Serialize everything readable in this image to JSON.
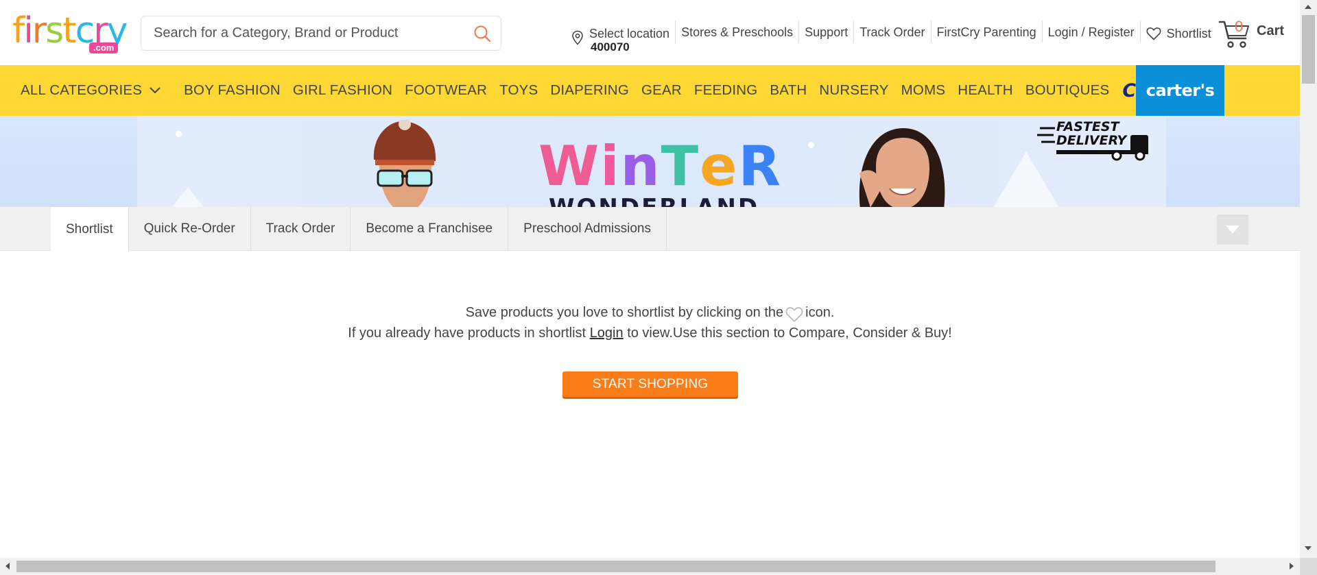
{
  "brand": {
    "logo_text": "firstcry",
    "logo_suffix": ".com"
  },
  "search": {
    "placeholder": "Search for a Category, Brand or Product"
  },
  "toplinks": {
    "location_label": "Select location",
    "location_code": "400070",
    "stores": "Stores & Preschools",
    "support": "Support",
    "track_order": "Track Order",
    "parenting": "FirstCry Parenting",
    "login": "Login / Register",
    "shortlist": "Shortlist",
    "cart_count": "0",
    "cart_label": "Cart"
  },
  "nav": {
    "all_categories": "ALL CATEGORIES",
    "items": [
      "BOY FASHION",
      "GIRL FASHION",
      "FOOTWEAR",
      "TOYS",
      "DIAPERING",
      "GEAR",
      "FEEDING",
      "BATH",
      "NURSERY",
      "MOMS",
      "HEALTH",
      "BOUTIQUES"
    ],
    "club": "Club",
    "carters": "carter's"
  },
  "banner": {
    "title": "WinTeR",
    "subtitle": "WONDERLAND",
    "delivery_line1": "FASTEST",
    "delivery_line2": "DELIVERY"
  },
  "tabs": {
    "items": [
      "Shortlist",
      "Quick Re-Order",
      "Track Order",
      "Become a Franchisee",
      "Preschool Admissions"
    ],
    "active": "Shortlist"
  },
  "empty_state": {
    "line1_before": "Save products you love to shortlist by clicking on the",
    "line1_after": "icon.",
    "line2_before": "If you already have products in shortlist",
    "line2_link": "Login",
    "line2_after": "to view.Use this section to Compare, Consider & Buy!",
    "button": "START SHOPPING"
  },
  "colors": {
    "nav_bg": "#fdd835",
    "accent_orange": "#fa7d19",
    "carters_blue": "#0a8fd8",
    "club_navy": "#1a237e"
  },
  "icons": [
    "search-icon",
    "location-pin-icon",
    "heart-icon",
    "cart-icon",
    "chevron-down-icon"
  ]
}
